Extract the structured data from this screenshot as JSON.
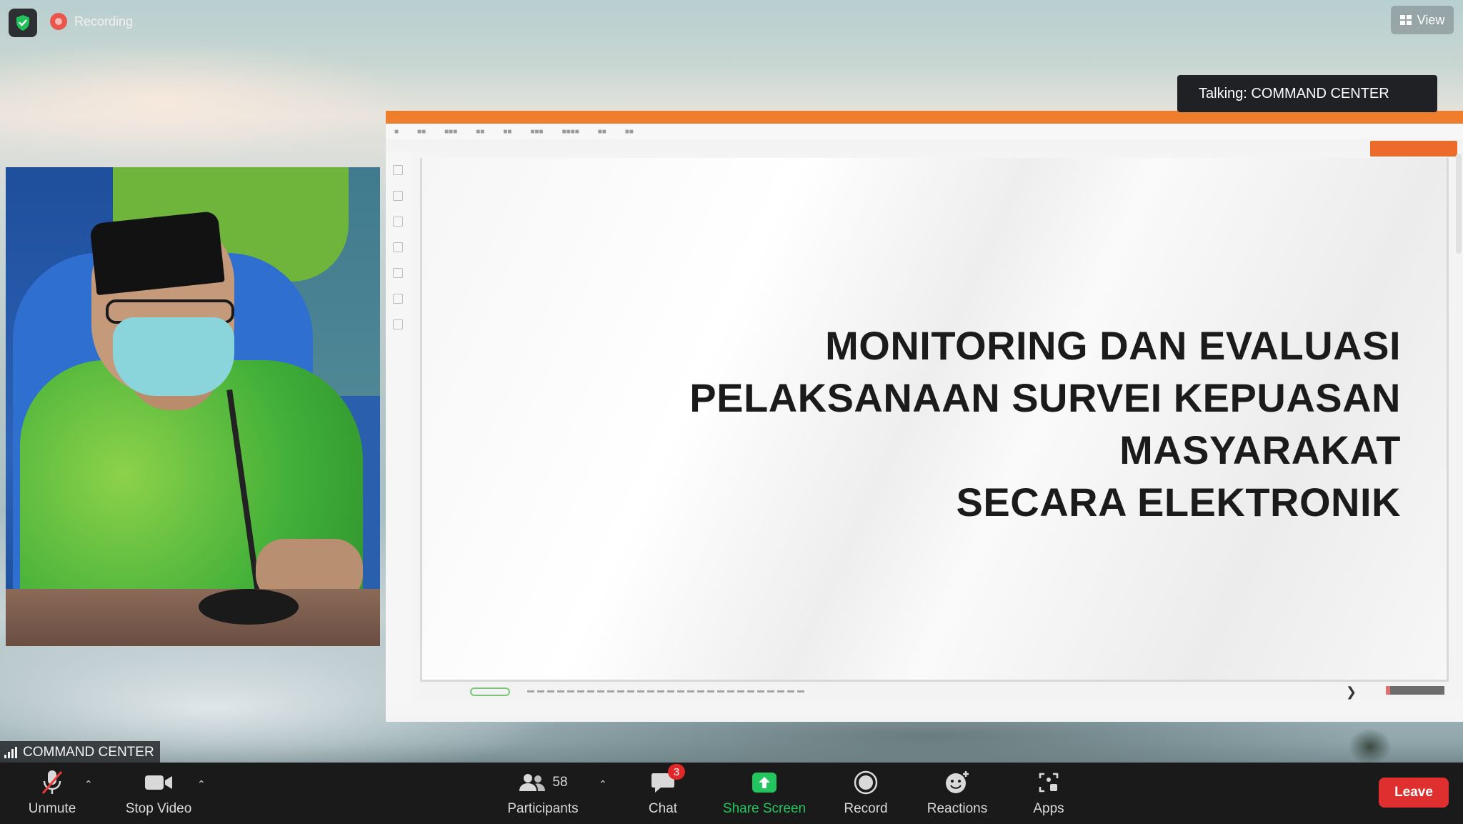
{
  "recording": {
    "label": "Recording"
  },
  "view_button": {
    "label": "View"
  },
  "talking_indicator": {
    "text": "Talking: COMMAND CENTER"
  },
  "participant_video": {
    "name": "COMMAND CENTER"
  },
  "shared_screen": {
    "slide_title_lines": [
      "MONITORING DAN EVALUASI",
      "PELAKSANAAN SURVEI KEPUASAN",
      "MASYARAKAT",
      "SECARA ELEKTRONIK"
    ]
  },
  "toolbar": {
    "unmute": "Unmute",
    "stop_video": "Stop Video",
    "participants": "Participants",
    "participants_count": "58",
    "chat": "Chat",
    "chat_badge": "3",
    "share_screen": "Share Screen",
    "record": "Record",
    "reactions": "Reactions",
    "apps": "Apps",
    "leave": "Leave"
  },
  "colors": {
    "toolbar_bg": "#1a1a1a",
    "share_green": "#22c55e",
    "leave_red": "#e02f2f",
    "app_orange": "#ee7d2c"
  },
  "icons": [
    "shield-icon",
    "record-dot-icon",
    "grid-icon",
    "signal-icon",
    "muted-mic-icon",
    "video-camera-icon",
    "participants-icon",
    "chat-icon",
    "share-screen-icon",
    "record-icon",
    "reactions-icon",
    "apps-icon"
  ]
}
